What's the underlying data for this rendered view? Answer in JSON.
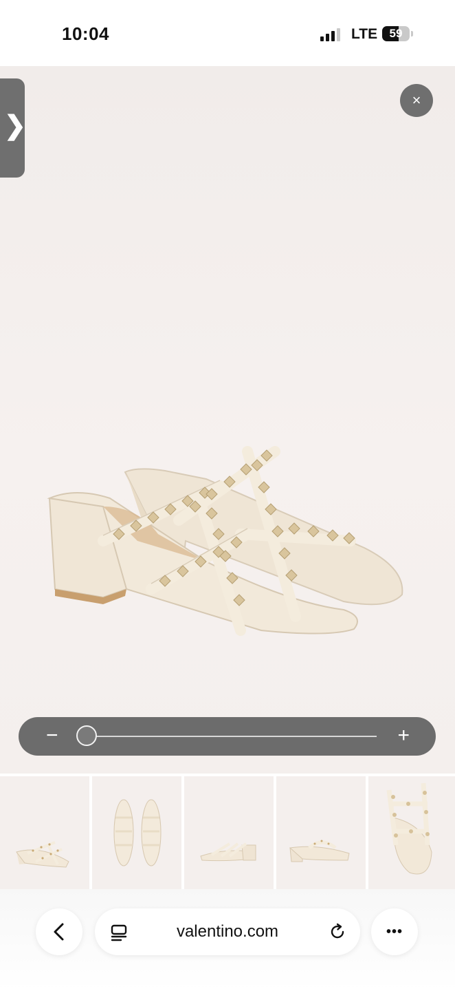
{
  "status": {
    "time": "10:04",
    "network": "LTE",
    "battery": "59",
    "signal_bars_active": 3
  },
  "viewer": {
    "open_panel_icon": "chevron-right-icon",
    "open_panel_glyph": "❯",
    "close_icon": "close-icon",
    "close_glyph": "×",
    "zoom": {
      "minus": "−",
      "plus": "+",
      "level": 0
    }
  },
  "thumbnails": [
    {
      "name": "thumbnail-1",
      "view": "pair-angled"
    },
    {
      "name": "thumbnail-2",
      "view": "pair-top"
    },
    {
      "name": "thumbnail-3",
      "view": "pair-side-low"
    },
    {
      "name": "thumbnail-4",
      "view": "single-side"
    },
    {
      "name": "thumbnail-5",
      "view": "close-up"
    }
  ],
  "browser": {
    "url": "valentino.com",
    "back_icon": "back-arrow-icon",
    "tabs_icon": "tab-overview-icon",
    "reload_icon": "reload-icon",
    "more_icon": "more-icon",
    "more_glyph": "•••"
  },
  "colors": {
    "overlay_control": "#6f6f6f",
    "product_ivory": "#f1e8d8",
    "stud_gold": "#d8c49a",
    "background_blush": "#f4efed"
  }
}
